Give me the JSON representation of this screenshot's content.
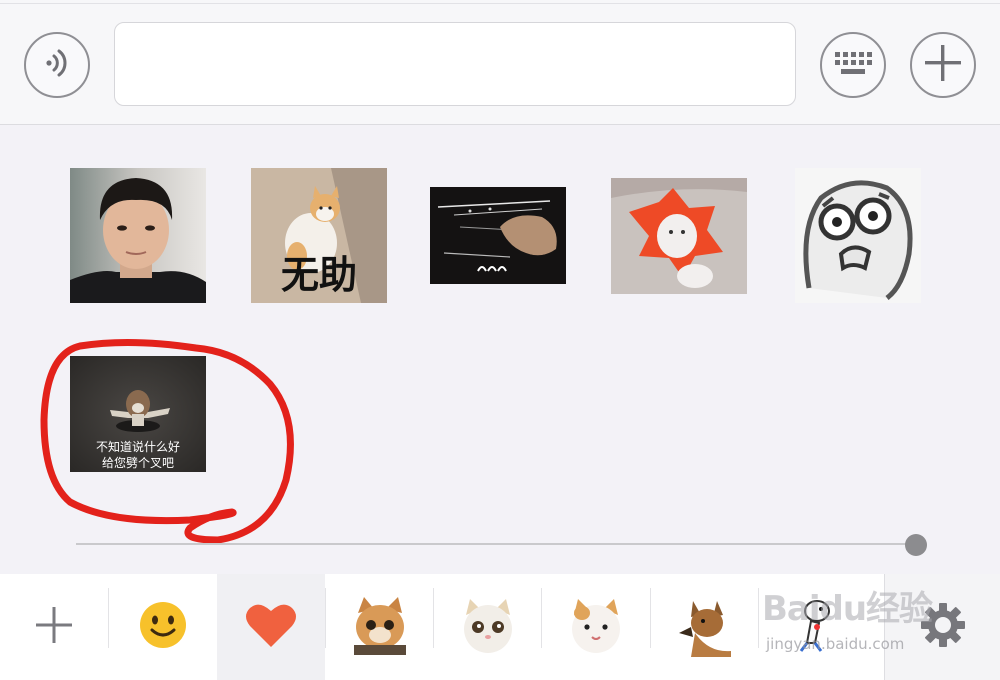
{
  "input_bar": {
    "voice_icon": "voice-icon",
    "text_input_value": "",
    "keyboard_icon": "keyboard-icon",
    "plus_icon": "plus-icon"
  },
  "stickers": {
    "items": [
      {
        "name": "sticker-man-portrait",
        "caption": ""
      },
      {
        "name": "sticker-cat-helpless",
        "caption": "无助"
      },
      {
        "name": "sticker-cat-paw-dark",
        "caption": ""
      },
      {
        "name": "sticker-cat-red-hood",
        "caption": ""
      },
      {
        "name": "sticker-shocked-face",
        "caption": ""
      },
      {
        "name": "sticker-dog-gesture",
        "caption_line1": "不知道说什么好",
        "caption_line2": "给您劈个叉吧"
      }
    ]
  },
  "annotation": {
    "color": "#e3221b"
  },
  "slider": {
    "position": 1.0
  },
  "tabs": {
    "items": [
      {
        "name": "add-tab",
        "icon": "plus-icon"
      },
      {
        "name": "emoji-tab",
        "icon": "smiley-icon"
      },
      {
        "name": "favorites-tab",
        "icon": "heart-icon",
        "selected": true
      },
      {
        "name": "sticker-pack-1",
        "icon": "cat-orange-icon"
      },
      {
        "name": "sticker-pack-2",
        "icon": "cat-white-icon"
      },
      {
        "name": "sticker-pack-3",
        "icon": "cat-calico-icon"
      },
      {
        "name": "sticker-pack-4",
        "icon": "dog-icon"
      },
      {
        "name": "sticker-pack-5",
        "icon": "cartoon-dog-icon"
      }
    ],
    "settings_icon": "gear-icon"
  },
  "watermark": {
    "main": "Baidu经验",
    "sub": "jingyan.baidu.com"
  },
  "colors": {
    "heart": "#f0613f",
    "emoji": "#f7c12b",
    "accent_red": "#e3221b"
  }
}
